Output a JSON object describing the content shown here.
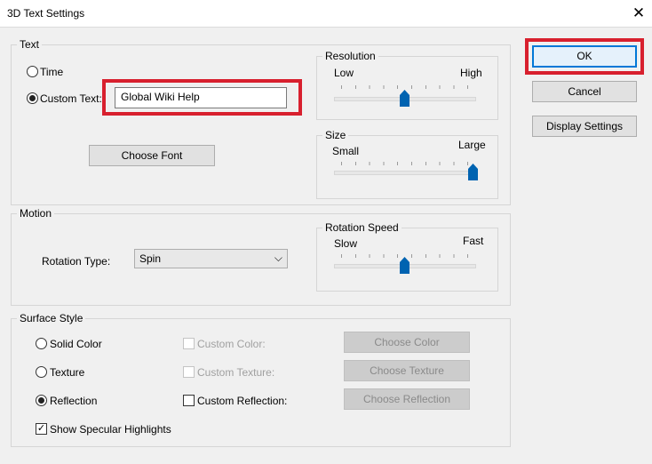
{
  "window": {
    "title": "3D Text Settings",
    "close_glyph": "✕"
  },
  "text_group": {
    "legend": "Text",
    "time_label": "Time",
    "custom_text_label": "Custom Text:",
    "custom_text_value": "Global Wiki Help",
    "choose_font_label": "Choose Font",
    "selected_option": "Custom Text"
  },
  "resolution": {
    "legend": "Resolution",
    "low_label": "Low",
    "high_label": "High",
    "level": 0.5
  },
  "size": {
    "legend": "Size",
    "small_label": "Small",
    "large_label": "Large",
    "level": 1.0
  },
  "motion": {
    "legend": "Motion",
    "rotation_type_label": "Rotation Type:",
    "rotation_type_value": "Spin",
    "chevron_glyph": "⌵"
  },
  "rotation_speed": {
    "legend": "Rotation Speed",
    "slow_label": "Slow",
    "fast_label": "Fast",
    "level": 0.5
  },
  "surface": {
    "legend": "Surface Style",
    "solid_color_label": "Solid Color",
    "texture_label": "Texture",
    "reflection_label": "Reflection",
    "custom_color_label": "Custom Color:",
    "custom_texture_label": "Custom Texture:",
    "custom_reflection_label": "Custom Reflection:",
    "choose_color_label": "Choose Color",
    "choose_texture_label": "Choose Texture",
    "choose_reflection_label": "Choose Reflection",
    "specular_label": "Show Specular Highlights",
    "selected_option": "Reflection",
    "specular_checked": true,
    "check_glyph": "✓"
  },
  "buttons": {
    "ok": "OK",
    "cancel": "Cancel",
    "display_settings": "Display Settings"
  },
  "colors": {
    "highlight": "#d8202e",
    "accent": "#0078d7",
    "slider_thumb": "#0063b1"
  }
}
